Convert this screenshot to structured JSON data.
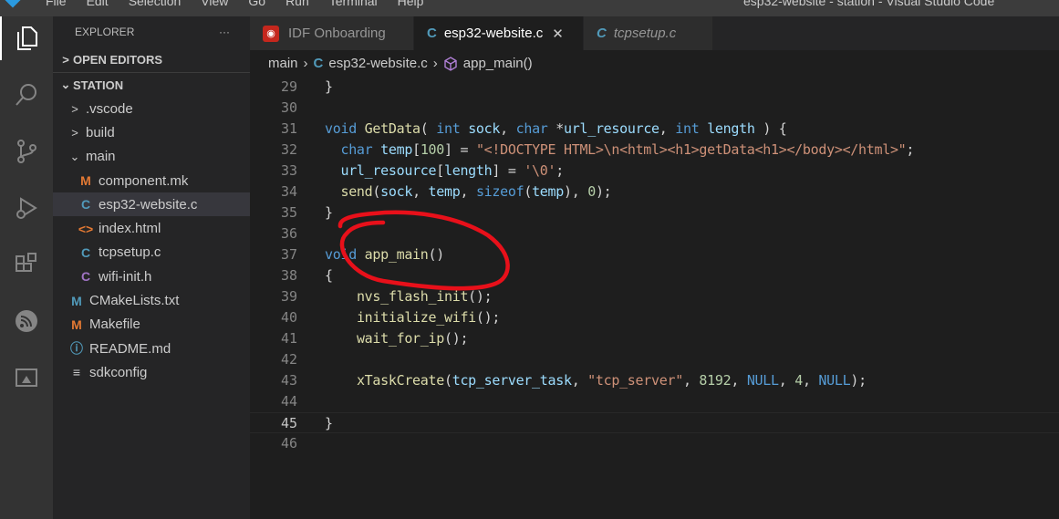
{
  "menubar": {
    "items": [
      "File",
      "Edit",
      "Selection",
      "View",
      "Go",
      "Run",
      "Terminal",
      "Help"
    ],
    "title": "esp32-website - station - Visual Studio Code"
  },
  "activity": [
    "files-icon",
    "search-icon",
    "source-control-icon",
    "run-debug-icon",
    "extensions-icon",
    "espressif-icon",
    "remote-explorer-icon"
  ],
  "sidebar": {
    "title": "EXPLORER",
    "more": "···",
    "open_editors": "OPEN EDITORS",
    "station": "STATION",
    "items": [
      {
        "label": ".vscode",
        "type": "folder",
        "chev": ">",
        "indent": 1
      },
      {
        "label": "build",
        "type": "folder",
        "chev": ">",
        "indent": 1
      },
      {
        "label": "main",
        "type": "folder",
        "chev": "⌄",
        "indent": 1
      },
      {
        "label": "component.mk",
        "icon": "M",
        "color": "#e37933",
        "indent": 2
      },
      {
        "label": "esp32-website.c",
        "icon": "C",
        "color": "#519aba",
        "indent": 2,
        "selected": true
      },
      {
        "label": "index.html",
        "icon": "<>",
        "color": "#e37933",
        "indent": 2
      },
      {
        "label": "tcpsetup.c",
        "icon": "C",
        "color": "#519aba",
        "indent": 2
      },
      {
        "label": "wifi-init.h",
        "icon": "C",
        "color": "#a074c4",
        "indent": 2
      },
      {
        "label": "CMakeLists.txt",
        "icon": "M",
        "color": "#519aba",
        "indent": 1
      },
      {
        "label": "Makefile",
        "icon": "M",
        "color": "#e37933",
        "indent": 1
      },
      {
        "label": "README.md",
        "icon": "ⓘ",
        "color": "#519aba",
        "indent": 1
      },
      {
        "label": "sdkconfig",
        "icon": "≡",
        "color": "#ccc",
        "indent": 1
      }
    ]
  },
  "tabs": [
    {
      "label": "IDF Onboarding",
      "icon": "espressif"
    },
    {
      "label": "esp32-website.c",
      "icon": "C",
      "active": true,
      "close": "✕"
    },
    {
      "label": "tcpsetup.c",
      "icon": "C",
      "italic": true
    }
  ],
  "breadcrumb": {
    "folder": "main",
    "file_icon": "C",
    "file": "esp32-website.c",
    "symbol": "app_main()"
  },
  "editor": {
    "current_line": 45,
    "lines": [
      {
        "n": 29,
        "t": [
          [
            "pl",
            "}"
          ]
        ]
      },
      {
        "n": 30,
        "t": []
      },
      {
        "n": 31,
        "t": [
          [
            "kw",
            "void"
          ],
          [
            "pl",
            " "
          ],
          [
            "fn",
            "GetData"
          ],
          [
            "pl",
            "( "
          ],
          [
            "kw",
            "int"
          ],
          [
            "pl",
            " "
          ],
          [
            "var",
            "sock"
          ],
          [
            "pl",
            ", "
          ],
          [
            "kw",
            "char"
          ],
          [
            "pl",
            " *"
          ],
          [
            "var",
            "url_resource"
          ],
          [
            "pl",
            ", "
          ],
          [
            "kw",
            "int"
          ],
          [
            "pl",
            " "
          ],
          [
            "var",
            "length"
          ],
          [
            "pl",
            " ) {"
          ]
        ]
      },
      {
        "n": 32,
        "t": [
          [
            "pl",
            "  "
          ],
          [
            "kw",
            "char"
          ],
          [
            "pl",
            " "
          ],
          [
            "var",
            "temp"
          ],
          [
            "pl",
            "["
          ],
          [
            "num",
            "100"
          ],
          [
            "pl",
            "] = "
          ],
          [
            "str",
            "\"<!DOCTYPE HTML>\\n<html><h1>getData<h1></body></html>\""
          ],
          [
            "pl",
            ";"
          ]
        ]
      },
      {
        "n": 33,
        "t": [
          [
            "pl",
            "  "
          ],
          [
            "var",
            "url_resource"
          ],
          [
            "pl",
            "["
          ],
          [
            "var",
            "length"
          ],
          [
            "pl",
            "] = "
          ],
          [
            "str",
            "'\\0'"
          ],
          [
            "pl",
            ";"
          ]
        ]
      },
      {
        "n": 34,
        "t": [
          [
            "pl",
            "  "
          ],
          [
            "fn",
            "send"
          ],
          [
            "pl",
            "("
          ],
          [
            "var",
            "sock"
          ],
          [
            "pl",
            ", "
          ],
          [
            "var",
            "temp"
          ],
          [
            "pl",
            ", "
          ],
          [
            "kw",
            "sizeof"
          ],
          [
            "pl",
            "("
          ],
          [
            "var",
            "temp"
          ],
          [
            "pl",
            "), "
          ],
          [
            "num",
            "0"
          ],
          [
            "pl",
            ");"
          ]
        ]
      },
      {
        "n": 35,
        "t": [
          [
            "pl",
            "}"
          ]
        ]
      },
      {
        "n": 36,
        "t": []
      },
      {
        "n": 37,
        "t": [
          [
            "kw",
            "void"
          ],
          [
            "pl",
            " "
          ],
          [
            "fn",
            "app_main"
          ],
          [
            "pl",
            "()"
          ]
        ]
      },
      {
        "n": 38,
        "t": [
          [
            "pl",
            "{"
          ]
        ]
      },
      {
        "n": 39,
        "t": [
          [
            "pl",
            "    "
          ],
          [
            "fn",
            "nvs_flash_init"
          ],
          [
            "pl",
            "();"
          ]
        ]
      },
      {
        "n": 40,
        "t": [
          [
            "pl",
            "    "
          ],
          [
            "fn",
            "initialize_wifi"
          ],
          [
            "pl",
            "();"
          ]
        ]
      },
      {
        "n": 41,
        "t": [
          [
            "pl",
            "    "
          ],
          [
            "fn",
            "wait_for_ip"
          ],
          [
            "pl",
            "();"
          ]
        ]
      },
      {
        "n": 42,
        "t": []
      },
      {
        "n": 43,
        "t": [
          [
            "pl",
            "    "
          ],
          [
            "fn",
            "xTaskCreate"
          ],
          [
            "pl",
            "("
          ],
          [
            "var",
            "tcp_server_task"
          ],
          [
            "pl",
            ", "
          ],
          [
            "str",
            "\"tcp_server\""
          ],
          [
            "pl",
            ", "
          ],
          [
            "num",
            "8192"
          ],
          [
            "pl",
            ", "
          ],
          [
            "kw",
            "NULL"
          ],
          [
            "pl",
            ", "
          ],
          [
            "num",
            "4"
          ],
          [
            "pl",
            ", "
          ],
          [
            "kw",
            "NULL"
          ],
          [
            "pl",
            ");"
          ]
        ]
      },
      {
        "n": 44,
        "t": []
      },
      {
        "n": 45,
        "t": [
          [
            "pl",
            "}"
          ]
        ]
      },
      {
        "n": 46,
        "t": []
      }
    ]
  },
  "annotation": {
    "color": "#e8101a"
  }
}
